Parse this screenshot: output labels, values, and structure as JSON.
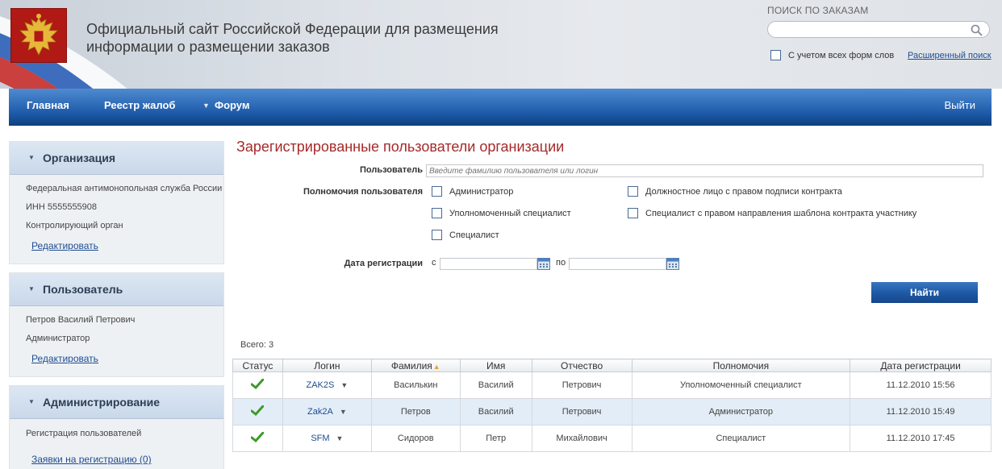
{
  "header": {
    "title_line1": "Официальный сайт Российской Федерации для размещения",
    "title_line2": "информации о размещении заказов",
    "search_label": "ПОИСК ПО ЗАКАЗАМ",
    "search_value": "",
    "word_forms_label": "С учетом всех форм слов",
    "advanced_search": "Расширенный поиск"
  },
  "nav": {
    "home": "Главная",
    "complaints": "Реестр жалоб",
    "forum": "Форум",
    "logout": "Выйти"
  },
  "sidebar": {
    "org": {
      "title": "Организация",
      "name": "Федеральная антимонопольная служба России",
      "inn": "ИНН 5555555908",
      "type": "Контролирующий орган",
      "edit": "Редактировать"
    },
    "user": {
      "title": "Пользователь",
      "name": "Петров Василий Петрович",
      "role": "Администратор",
      "edit": "Редактировать"
    },
    "admin": {
      "title": "Администрирование",
      "item1": "Регистрация пользователей",
      "item2": "Заявки на регистрацию (0)"
    }
  },
  "main": {
    "title": "Зарегистрированные пользователи организации",
    "user_label": "Пользователь",
    "user_placeholder": "Введите фамилию пользователя или логин",
    "perm_label": "Полномочия пользователя",
    "perms": {
      "admin": "Администратор",
      "authorized": "Уполномоченный специалист",
      "specialist": "Специалист",
      "signer": "Должностное лицо с правом подписи контракта",
      "template": "Специалист с правом направления шаблона контракта участнику"
    },
    "date_label": "Дата регистрации",
    "date_from": "с",
    "date_to": "по",
    "find": "Найти",
    "total": "Всего: 3"
  },
  "table": {
    "headers": [
      "Статус",
      "Логин",
      "Фамилия",
      "Имя",
      "Отчество",
      "Полномочия",
      "Дата регистрации"
    ],
    "rows": [
      {
        "login": "ZAK2S",
        "surname": "Василькин",
        "name": "Василий",
        "patronymic": "Петрович",
        "role": "Уполномоченный специалист",
        "date": "11.12.2010 15:56"
      },
      {
        "login": "Zak2A",
        "surname": "Петров",
        "name": "Василий",
        "patronymic": "Петрович",
        "role": "Администратор",
        "date": "11.12.2010 15:49"
      },
      {
        "login": "SFM",
        "surname": "Сидоров",
        "name": "Петр",
        "patronymic": "Михайлович",
        "role": "Специалист",
        "date": "11.12.2010 17:45"
      }
    ]
  },
  "colors": {
    "nav_blue": "#1c57a5",
    "title_red": "#a52a2a",
    "link_blue": "#1e4c91",
    "check_green": "#3d9a2b",
    "selected_row": "#e3edf7"
  }
}
